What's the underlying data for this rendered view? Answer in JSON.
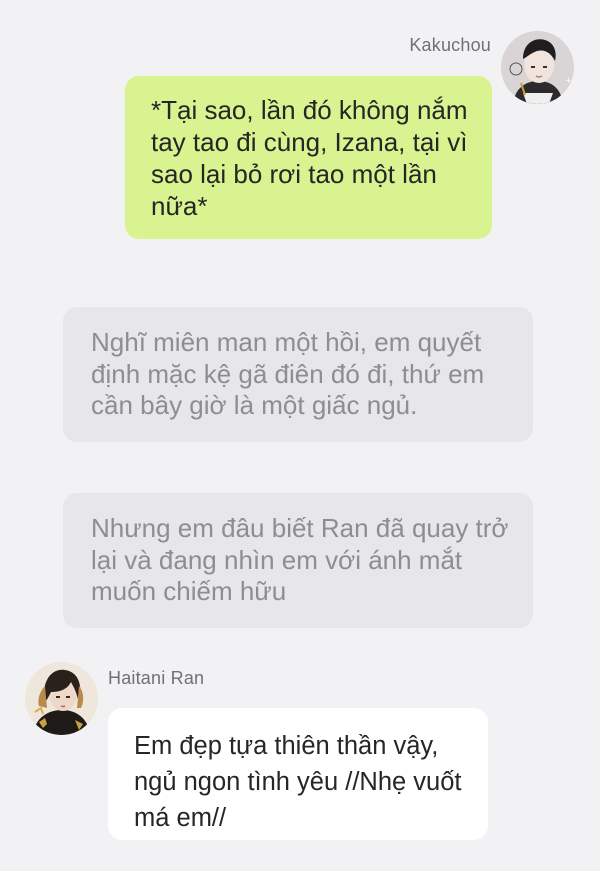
{
  "messages": [
    {
      "type": "sent",
      "sender": "Kakuchou",
      "avatar_icon": "kakuchou-avatar",
      "text": "*Tại sao, lần đó không nắm tay tao đi cùng, Izana, tại vì sao lại bỏ rơi tao một lần nữa*"
    },
    {
      "type": "narration",
      "text": "Nghĩ miên man một hồi, em quyết định mặc kệ gã điên đó đi, thứ em cần bây giờ là một giấc ngủ."
    },
    {
      "type": "narration",
      "text": "Nhưng em đâu biết Ran đã quay trở lại và đang nhìn em với ánh mắt muốn chiếm hữu"
    },
    {
      "type": "received",
      "sender": "Haitani Ran",
      "avatar_icon": "haitani-ran-avatar",
      "text": "Em đẹp tựa thiên thần vậy, ngủ ngon tình yêu //Nhẹ vuốt má em//"
    }
  ],
  "colors": {
    "background": "#f2f2f4",
    "sent_bubble": "#d8f38f",
    "narration_bubble": "#e7e7ea",
    "narration_text": "#8d8d92",
    "received_bubble": "#ffffff",
    "sender_name": "#707075"
  }
}
